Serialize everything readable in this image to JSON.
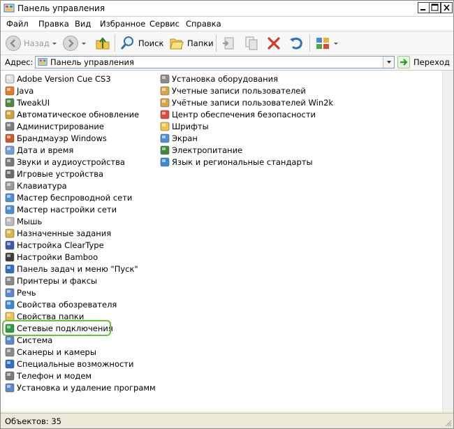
{
  "window": {
    "title": "Панель управления"
  },
  "menu": [
    "Файл",
    "Правка",
    "Вид",
    "Избранное",
    "Сервис",
    "Справка"
  ],
  "toolbar": {
    "back_label": "Назад",
    "search_label": "Поиск",
    "folders_label": "Папки"
  },
  "address": {
    "label": "Адрес:",
    "value": "Панель управления",
    "go_label": "Переход"
  },
  "items_left": [
    {
      "label": "Adobe Version Cue CS3",
      "icon": "adobe-icon"
    },
    {
      "label": "Java",
      "icon": "java-icon"
    },
    {
      "label": "TweakUI",
      "icon": "tweakui-icon"
    },
    {
      "label": "Автоматическое обновление",
      "icon": "update-icon"
    },
    {
      "label": "Администрирование",
      "icon": "admin-tools-icon"
    },
    {
      "label": "Брандмауэр Windows",
      "icon": "firewall-icon"
    },
    {
      "label": "Дата и время",
      "icon": "clock-icon"
    },
    {
      "label": "Звуки и аудиоустройства",
      "icon": "speaker-icon"
    },
    {
      "label": "Игровые устройства",
      "icon": "gamepad-icon"
    },
    {
      "label": "Клавиатура",
      "icon": "keyboard-icon"
    },
    {
      "label": "Мастер беспроводной сети",
      "icon": "wireless-icon"
    },
    {
      "label": "Мастер настройки сети",
      "icon": "network-wizard-icon"
    },
    {
      "label": "Мышь",
      "icon": "mouse-icon"
    },
    {
      "label": "Назначенные задания",
      "icon": "tasks-icon"
    },
    {
      "label": "Настройка ClearType",
      "icon": "cleartype-icon"
    },
    {
      "label": "Настройки Bamboo",
      "icon": "bamboo-icon"
    },
    {
      "label": "Панель задач и меню \"Пуск\"",
      "icon": "taskbar-icon"
    },
    {
      "label": "Принтеры и факсы",
      "icon": "printer-icon"
    },
    {
      "label": "Речь",
      "icon": "speech-icon"
    },
    {
      "label": "Свойства обозревателя",
      "icon": "internet-options-icon"
    },
    {
      "label": "Свойства папки",
      "icon": "folder-options-icon"
    },
    {
      "label": "Сетевые подключения",
      "icon": "network-connections-icon"
    },
    {
      "label": "Система",
      "icon": "system-icon"
    },
    {
      "label": "Сканеры и камеры",
      "icon": "scanner-icon"
    },
    {
      "label": "Специальные возможности",
      "icon": "accessibility-icon"
    },
    {
      "label": "Телефон и модем",
      "icon": "phone-modem-icon"
    },
    {
      "label": "Установка и удаление программ",
      "icon": "add-remove-icon"
    }
  ],
  "items_right": [
    {
      "label": "Установка оборудования",
      "icon": "hardware-icon"
    },
    {
      "label": "Учетные записи пользователей",
      "icon": "users-icon"
    },
    {
      "label": "Учётные записи пользователей Win2k",
      "icon": "users-win2k-icon"
    },
    {
      "label": "Центр обеспечения безопасности",
      "icon": "security-center-icon"
    },
    {
      "label": "Шрифты",
      "icon": "fonts-icon"
    },
    {
      "label": "Экран",
      "icon": "display-icon"
    },
    {
      "label": "Электропитание",
      "icon": "power-icon"
    },
    {
      "label": "Язык и региональные стандарты",
      "icon": "regional-icon"
    }
  ],
  "selected_item": "Сетевые подключения",
  "colors": {
    "selection_outline": "#6cbf3c",
    "window_bg": "#ece9d8"
  },
  "status": {
    "text": "Объектов: 35"
  }
}
